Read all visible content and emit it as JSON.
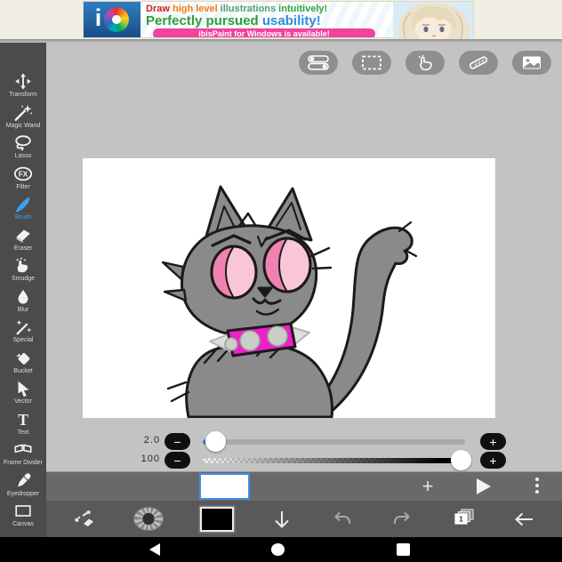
{
  "colors": {
    "accent_blue": "#3aa0f0",
    "selection_border_blue": "#3f8fe8",
    "pill_pink": "#f0439c",
    "logo_blue": "#1d5d9e",
    "cat_body_gray": "#8a8a8a",
    "cat_eye_pink_light": "#f9c6d7",
    "cat_eye_pink_dark": "#ef82ae",
    "cat_collar_magenta": "#ef1fc9",
    "sidebar_bg": "#4b4b4b",
    "workspace_bg": "#c3c3c3",
    "toolbar_bg": "#595959"
  },
  "banner": {
    "logo_text": "i",
    "line1": [
      {
        "text": "Draw ",
        "style": "color:#d42417"
      },
      {
        "text": "high level ",
        "style": "color:#f07d12"
      },
      {
        "text": "illustrations ",
        "style": "color:#4fa06e"
      },
      {
        "text": "intuitively!",
        "style": "color:#2fa43a"
      }
    ],
    "line2": [
      {
        "text": "Perfectly pursued ",
        "style": "color:#2f9e38"
      },
      {
        "text": "usability!",
        "style": "color:#2e8fd8"
      }
    ],
    "pill": "ibisPaint for Windows is available!"
  },
  "sidebar": {
    "fx_label": "FX",
    "text_glyph": "T",
    "tools": [
      {
        "label": "Transform",
        "icon": "transform-icon",
        "selected": false
      },
      {
        "label": "Magic Wand",
        "icon": "magic-wand-icon",
        "selected": false
      },
      {
        "label": "Lasso",
        "icon": "lasso-icon",
        "selected": false
      },
      {
        "label": "Filter",
        "icon": "filter-icon",
        "selected": false
      },
      {
        "label": "Brush",
        "icon": "brush-icon",
        "selected": true
      },
      {
        "label": "Eraser",
        "icon": "eraser-icon",
        "selected": false
      },
      {
        "label": "Smudge",
        "icon": "smudge-icon",
        "selected": false
      },
      {
        "label": "Blur",
        "icon": "blur-icon",
        "selected": false
      },
      {
        "label": "Special",
        "icon": "special-pen-icon",
        "selected": false
      },
      {
        "label": "Bucket",
        "icon": "bucket-icon",
        "selected": false
      },
      {
        "label": "Vector",
        "icon": "vector-icon",
        "selected": false
      },
      {
        "label": "Text",
        "icon": "text-icon",
        "selected": false
      },
      {
        "label": "Frame Divider",
        "icon": "frame-divider-icon",
        "selected": false
      },
      {
        "label": "Eyedropper",
        "icon": "eyedropper-icon",
        "selected": false
      },
      {
        "label": "Canvas",
        "icon": "canvas-icon",
        "selected": false
      }
    ]
  },
  "top_toolbar": {
    "buttons": [
      "toggle-settings-icon",
      "select-rectangle-icon",
      "hand-gesture-icon",
      "ruler-icon",
      "material-image-icon"
    ]
  },
  "sliders": {
    "minus_glyph": "−",
    "plus_glyph": "+",
    "rows": [
      {
        "name": "brush-size",
        "value": "2.0"
      },
      {
        "name": "opacity",
        "value": "100"
      }
    ]
  },
  "frame_bar": {
    "add_glyph": "+",
    "icons": [
      "add-frame-icon",
      "play-icon",
      "more-options-icon"
    ]
  },
  "bottom_toolbar": {
    "layers_count": "1",
    "icons": [
      "swap-pen-eraser-icon",
      "brush-preview-icon",
      "color-swatch",
      "down-arrow-icon",
      "undo-icon",
      "redo-icon",
      "layers-icon",
      "back-arrow-icon"
    ]
  },
  "nav_bar": {
    "icons": [
      "back-icon",
      "home-icon",
      "recents-icon"
    ]
  }
}
